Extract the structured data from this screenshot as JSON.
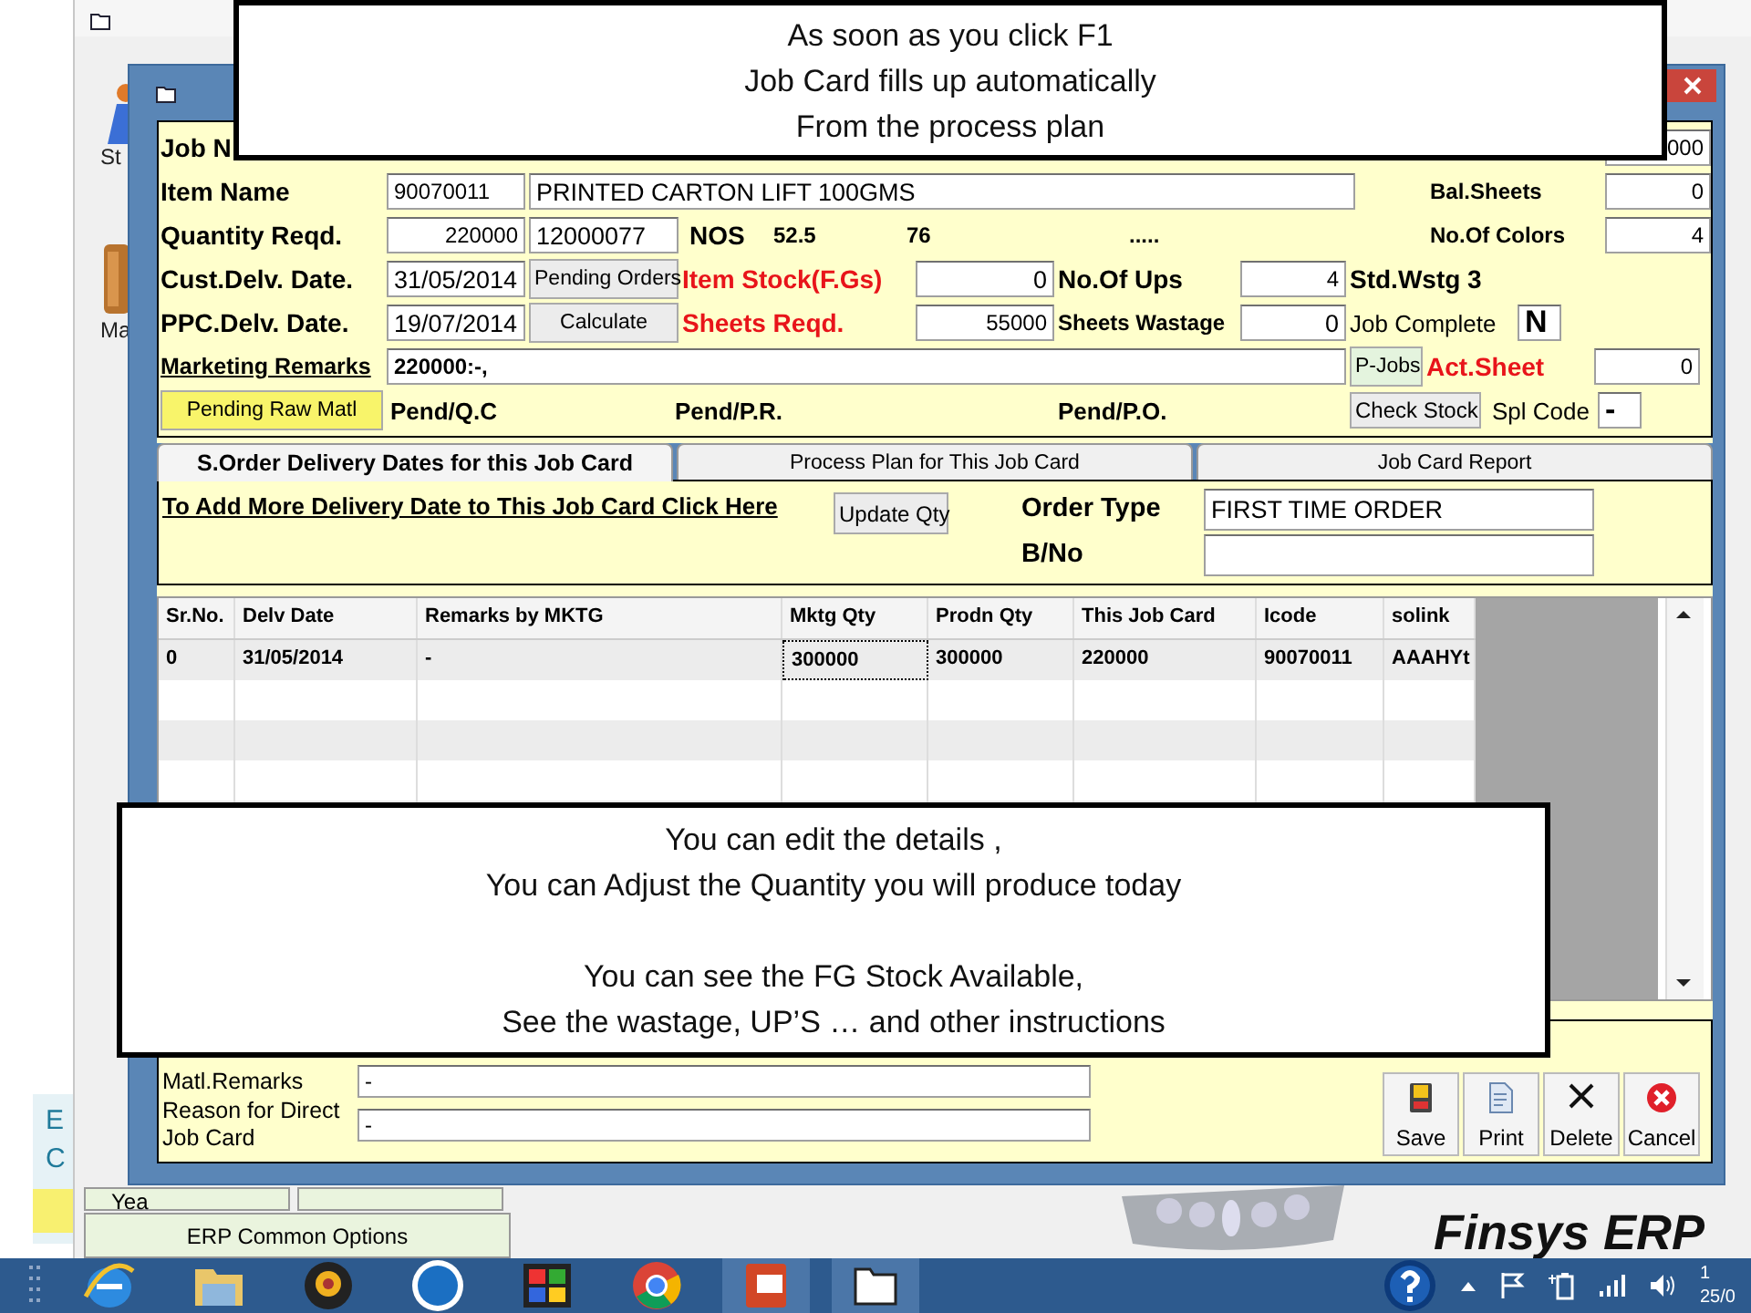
{
  "desktop": {
    "icon_labels": [
      "St",
      "Ma"
    ],
    "side_panel_lines": [
      "E",
      "C"
    ],
    "buttons": [
      "Yea"
    ],
    "common_options_button": "ERP Common Options",
    "brand": "Finsys ERP"
  },
  "dialog": {
    "form": {
      "job_no_label": "Job N",
      "corner_value": "000",
      "item_name": {
        "label": "Item Name",
        "code": "90070011",
        "description": "PRINTED CARTON LIFT 100GMS"
      },
      "quantity": {
        "label": "Quantity Reqd.",
        "value": "220000",
        "code": "12000077",
        "unit": "NOS",
        "figures": [
          "52.5",
          "76",
          "....."
        ]
      },
      "cust_delv": {
        "label": "Cust.Delv. Date.",
        "value": "31/05/2014",
        "button": "Pending Orders"
      },
      "ppc_delv": {
        "label": "PPC.Delv. Date.",
        "value": "19/07/2014",
        "button": "Calculate"
      },
      "item_stock": {
        "label": "Item Stock(F.Gs)",
        "value": "0"
      },
      "sheets_reqd": {
        "label": "Sheets Reqd.",
        "value": "55000"
      },
      "no_of_ups": {
        "label": "No.Of Ups",
        "value": "4"
      },
      "sheets_wastage": {
        "label": "Sheets Wastage",
        "value": "0"
      },
      "marketing_remarks": {
        "label": "Marketing Remarks",
        "value": "220000:-,"
      },
      "p_jobs_button": "P-Jobs",
      "pending_raw_matl_button": "Pending Raw Matl",
      "pend": [
        "Pend/Q.C",
        "Pend/P.R.",
        "Pend/P.O."
      ],
      "check_stock_button": "Check Stock",
      "bal_sheets": {
        "label": "Bal.Sheets",
        "value": "0"
      },
      "no_of_colors": {
        "label": "No.Of Colors",
        "value": "4"
      },
      "std_wstg": "Std.Wstg  3",
      "job_complete": {
        "label": "Job Complete",
        "value": "N"
      },
      "act_sheet": {
        "label": "Act.Sheet",
        "value": "0"
      },
      "spl_code": {
        "label": "Spl Code",
        "value": "-"
      }
    },
    "tabs": [
      {
        "label": "S.Order Delivery Dates for this Job Card",
        "selected": true
      },
      {
        "label": "Process Plan for This Job Card",
        "selected": false
      },
      {
        "label": "Job Card Report",
        "selected": false
      }
    ],
    "delivery": {
      "link": "To Add More Delivery Date to This Job Card Click Here",
      "update_button": "Update Qty",
      "order_type": {
        "label": "Order Type",
        "value": "FIRST TIME ORDER"
      },
      "b_no": {
        "label": "B/No"
      }
    },
    "table": {
      "columns": [
        "Sr.No.",
        "Delv Date",
        "Remarks by MKTG",
        "Mktg Qty",
        "Prodn Qty",
        "This Job Card",
        "Icode",
        "solink"
      ],
      "rows": [
        {
          "cells": [
            {
              "text": "0",
              "focused": false
            },
            {
              "text": "31/05/2014",
              "focused": false
            },
            {
              "text": "-",
              "focused": false
            },
            {
              "text": "300000",
              "focused": true
            },
            {
              "text": "300000",
              "focused": false
            },
            {
              "text": "220000",
              "focused": false
            },
            {
              "text": "90070011",
              "focused": false
            },
            {
              "text": "AAAHYt",
              "focused": false
            }
          ]
        }
      ]
    },
    "bottom": {
      "matl_remarks": {
        "label": "Matl.Remarks",
        "value": "-"
      },
      "reason": {
        "label": "Reason for Direct Job Card",
        "value": "-"
      }
    },
    "actions": [
      {
        "kind": "save",
        "label": "Save"
      },
      {
        "kind": "print",
        "label": "Print"
      },
      {
        "kind": "delete",
        "label": "Delete"
      },
      {
        "kind": "cancel",
        "label": "Cancel"
      }
    ]
  },
  "callouts": [
    {
      "paragraphs": [
        [
          "As soon as you click F1",
          "Job Card fills up automatically",
          "From the process plan"
        ]
      ]
    },
    {
      "paragraphs": [
        [
          "You can edit the details ,",
          "You can Adjust the Quantity you will produce today"
        ],
        [
          "You can see the  FG Stock Available,",
          "See the wastage, UP’S … and other instructions"
        ]
      ]
    }
  ],
  "taskbar": {
    "clock": [
      "1",
      "25/0"
    ]
  }
}
